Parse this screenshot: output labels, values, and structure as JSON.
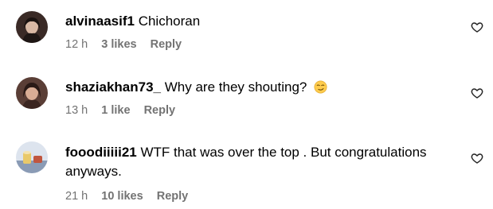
{
  "comments": [
    {
      "username": "alvinaasif1",
      "text": "Chichoran",
      "time": "12 h",
      "likes": "3 likes",
      "reply": "Reply",
      "emoji": ""
    },
    {
      "username": "shaziakhan73_",
      "text": "Why are they shouting?",
      "time": "13 h",
      "likes": "1 like",
      "reply": "Reply",
      "emoji": "smirk-face-emoji"
    },
    {
      "username": "fooodiiiii21",
      "text": "WTF that was over the top . But congratulations anyways.",
      "time": "21 h",
      "likes": "10 likes",
      "reply": "Reply",
      "emoji": ""
    }
  ],
  "icons": {
    "like": "heart-outline-icon"
  },
  "colors": {
    "meta_text": "#737373",
    "text": "#000000"
  }
}
